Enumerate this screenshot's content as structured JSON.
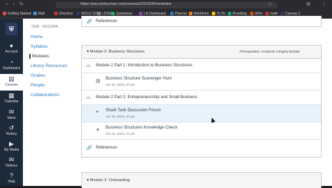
{
  "browser": {
    "url": "https://psu.instructure.com/courses/2223245/modules",
    "bookmarks": [
      "Getting Started",
      "Mail",
      "Directory",
      "WCLD 101",
      "LDOE",
      "Quickbase",
      "LA Dashboard",
      "Planner",
      "Workfront",
      "To Do",
      "Branding",
      "Wiris",
      "math",
      "Canvas 2"
    ]
  },
  "global_nav": {
    "items": [
      {
        "label": "Account",
        "icon": "account-icon"
      },
      {
        "label": "Dashboard",
        "icon": "dashboard-icon"
      },
      {
        "label": "Courses",
        "icon": "courses-icon"
      },
      {
        "label": "Calendar",
        "icon": "calendar-icon"
      },
      {
        "label": "Inbox",
        "icon": "inbox-icon"
      },
      {
        "label": "History",
        "icon": "history-icon"
      },
      {
        "label": "My Media",
        "icon": "media-icon"
      },
      {
        "label": "Notices",
        "icon": "notices-icon"
      },
      {
        "label": "Help",
        "icon": "help-icon"
      }
    ]
  },
  "course": {
    "crumb": "2228 · 202223PA",
    "nav": [
      "Home",
      "Syllabus",
      "Modules",
      "Library Resources",
      "Grades",
      "People",
      "Collaborations"
    ]
  },
  "top_row": {
    "title": "References"
  },
  "module2": {
    "title": "Module 2: Business Structures",
    "prereq": "Prerequisites: Academic Integrity Module",
    "items": [
      {
        "type": "page",
        "title": "Module 2 Part 1: Introduction to Business Structures",
        "meta": ""
      },
      {
        "type": "assignment",
        "title": "Business Structure Scavenger Hunt",
        "meta": "Jan 22, 2023  |  20 pts"
      },
      {
        "type": "page",
        "title": "Module 2 Part 2: Entrepreneurship and Small Business",
        "meta": ""
      },
      {
        "type": "discussion",
        "title": "Shark Tank Discussion Forum",
        "meta": "Jan 29, 2023  |  25 pts"
      },
      {
        "type": "quiz",
        "title": "Business Structures Knowledge Check",
        "meta": "Jan 29, 2023  |  10 pts"
      },
      {
        "type": "link",
        "title": "References",
        "meta": ""
      }
    ]
  },
  "module3": {
    "title": "Module 3: Onboarding"
  }
}
